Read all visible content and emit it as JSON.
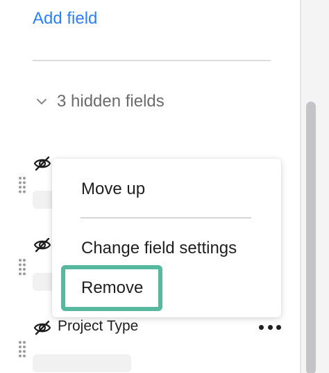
{
  "fields_panel": {
    "add_field_label": "Add field",
    "hidden_section_label": "3 hidden fields",
    "visible_field_name": "Project Type"
  },
  "context_menu": {
    "items": [
      {
        "label": "Move up"
      },
      {
        "label": "Change field settings"
      },
      {
        "label": "Remove"
      }
    ]
  },
  "icons": {
    "chevron": "chevron-down-icon",
    "hidden": "eye-slash-icon",
    "grip": "drag-handle-icon",
    "more": "more-options-icon"
  },
  "colors": {
    "link_blue": "#2d7ff9",
    "highlight_green": "#56b89f",
    "muted_text": "#6b6b6b",
    "text": "#1f1f1f"
  }
}
